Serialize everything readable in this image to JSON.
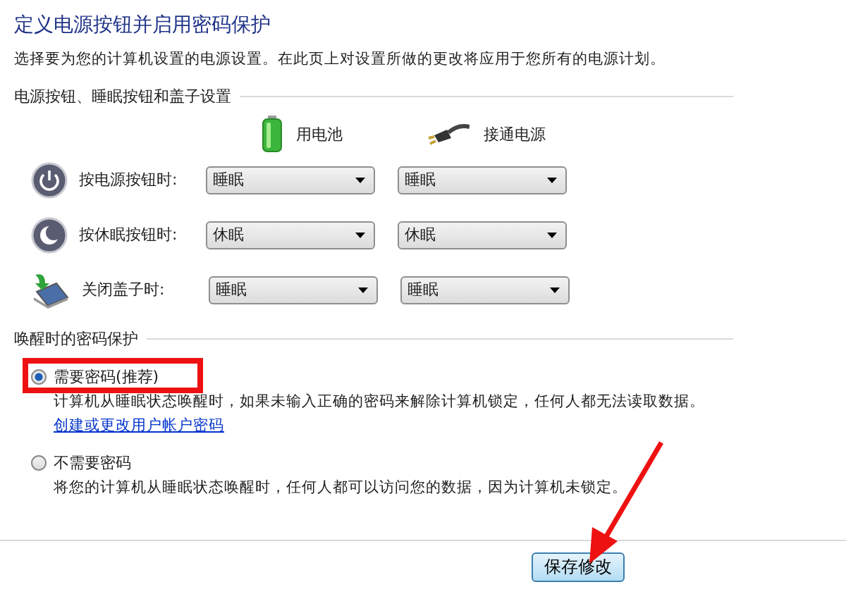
{
  "title": "定义电源按钮并启用密码保护",
  "intro": "选择要为您的计算机设置的电源设置。在此页上对设置所做的更改将应用于您所有的电源计划。",
  "buttons_section": {
    "heading": "电源按钮、睡眠按钮和盖子设置",
    "columns": [
      {
        "kind": "battery",
        "label": "用电池"
      },
      {
        "kind": "plug",
        "label": "接通电源"
      }
    ],
    "rows": [
      {
        "kind": "power",
        "label": "按电源按钮时:",
        "on_battery": "睡眠",
        "plugged_in": "睡眠"
      },
      {
        "kind": "sleep",
        "label": "按休眠按钮时:",
        "on_battery": "休眠",
        "plugged_in": "休眠"
      },
      {
        "kind": "lid",
        "label": "关闭盖子时:",
        "on_battery": "睡眠",
        "plugged_in": "睡眠"
      }
    ]
  },
  "password_section": {
    "heading": "唤醒时的密码保护",
    "options": [
      {
        "label": "需要密码(推荐)",
        "selected": true,
        "description": "计算机从睡眠状态唤醒时，如果未输入正确的密码来解除计算机锁定，任何人都无法读取数据。",
        "link": "创建或更改用户帐户密码"
      },
      {
        "label": "不需要密码",
        "selected": false,
        "description": "将您的计算机从睡眠状态唤醒时，任何人都可以访问您的数据，因为计算机未锁定。"
      }
    ]
  },
  "save_button": "保存修改"
}
